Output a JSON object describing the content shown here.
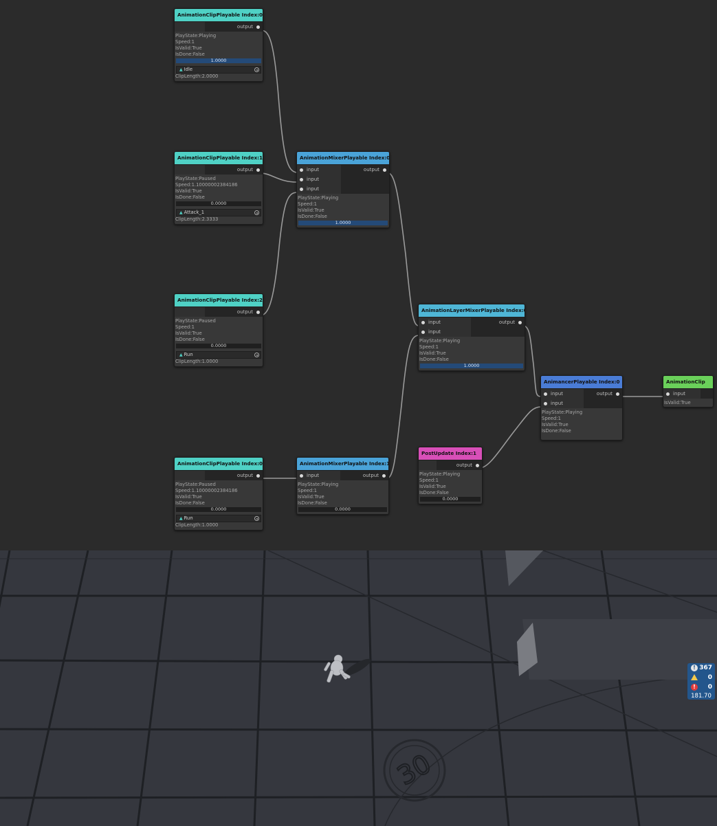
{
  "colors": {
    "clip_header": "#4fd1c5",
    "mixer_header": "#4aa3d8",
    "layer_header": "#4fb6d6",
    "animancer_header": "#4a7cd6",
    "postupdate_header": "#d84fb8",
    "output_clip_header": "#6ad05a",
    "weight_bar": "#244a78",
    "console_badge": "#23568c"
  },
  "port_labels": {
    "input": "input",
    "output": "output"
  },
  "nodes": {
    "clip0": {
      "title": "AnimationClipPlayable Index:0",
      "play_state": "PlayState:Playing",
      "speed": "Speed:1",
      "is_valid": "IsValid:True",
      "is_done": "IsDone:False",
      "weight": "1.0000",
      "clip_name": "Idle",
      "clip_length": "ClipLength:2.0000"
    },
    "clip1": {
      "title": "AnimationClipPlayable Index:1",
      "play_state": "PlayState:Paused",
      "speed": "Speed:1.10000002384186",
      "is_valid": "IsValid:True",
      "is_done": "IsDone:False",
      "weight": "0.0000",
      "clip_name": "Attack_1",
      "clip_length": "ClipLength:2.3333"
    },
    "clip2": {
      "title": "AnimationClipPlayable Index:2",
      "play_state": "PlayState:Paused",
      "speed": "Speed:1",
      "is_valid": "IsValid:True",
      "is_done": "IsDone:False",
      "weight": "0.0000",
      "clip_name": "Run",
      "clip_length": "ClipLength:1.0000"
    },
    "clip3": {
      "title": "AnimationClipPlayable Index:0",
      "play_state": "PlayState:Paused",
      "speed": "Speed:1.10000002384186",
      "is_valid": "IsValid:True",
      "is_done": "IsDone:False",
      "weight": "0.0000",
      "clip_name": "Run",
      "clip_length": "ClipLength:1.0000"
    },
    "mixer0": {
      "title": "AnimationMixerPlayable Index:0",
      "play_state": "PlayState:Playing",
      "speed": "Speed:1",
      "is_valid": "IsValid:True",
      "is_done": "IsDone:False",
      "weight": "1.0000"
    },
    "mixer1": {
      "title": "AnimationMixerPlayable Index:1",
      "play_state": "PlayState:Playing",
      "speed": "Speed:1",
      "is_valid": "IsValid:True",
      "is_done": "IsDone:False",
      "weight": "0.0000"
    },
    "layer0": {
      "title": "AnimationLayerMixerPlayable Index:0",
      "play_state": "PlayState:Playing",
      "speed": "Speed:1",
      "is_valid": "IsValid:True",
      "is_done": "IsDone:False",
      "weight": "1.0000"
    },
    "postupdate1": {
      "title": "PostUpdate Index:1",
      "play_state": "PlayState:Playing",
      "speed": "Speed:1",
      "is_valid": "IsValid:True",
      "is_done": "IsDone:False",
      "weight": "0.0000"
    },
    "animancer0": {
      "title": "AnimancerPlayable Index:0",
      "play_state": "PlayState:Playing",
      "speed": "Speed:1",
      "is_valid": "IsValid:True",
      "is_done": "IsDone:False"
    },
    "output_clip": {
      "title": "AnimationClip",
      "is_valid": "IsValid:True"
    }
  },
  "console_badge": {
    "info_count": "367",
    "warning_count": "0",
    "error_count": "0",
    "fps": "181.70"
  },
  "scene": {
    "floor_marker": "30"
  }
}
